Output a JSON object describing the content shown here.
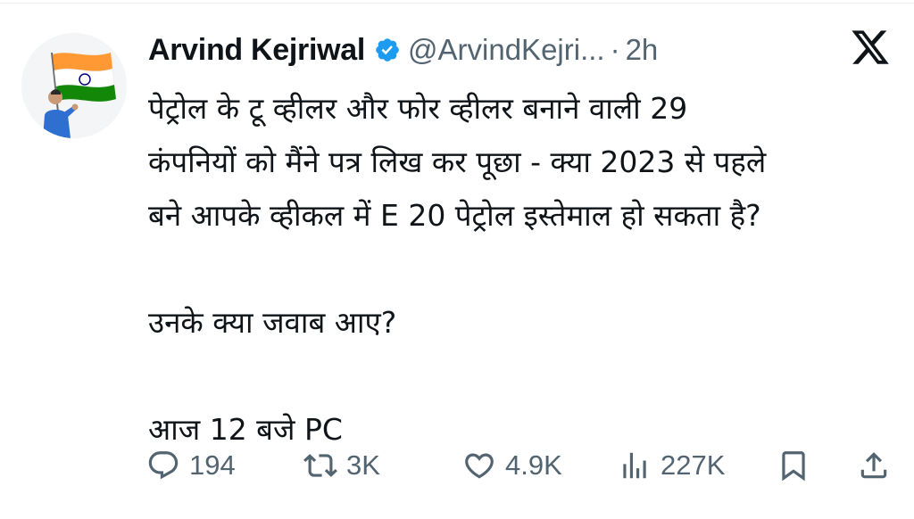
{
  "author": {
    "display_name": "Arvind Kejriwal",
    "handle": "@ArvindKejri...",
    "separator": "·",
    "time": "2h",
    "verified_color": "#1d9bf0"
  },
  "tweet": {
    "text": "पेट्रोल के टू व्हीलर और फोर व्हीलर बनाने वाली 29\nकंपनियों को मैंने पत्र लिख कर पूछा - क्या 2023 से पहले\nबने आपके व्हीकल में E 20 पेट्रोल इस्तेमाल हो सकता है?\n\nउनके क्या जवाब आए?\n\nआज 12 बजे PC"
  },
  "actions": {
    "replies": "194",
    "retweets": "3K",
    "likes": "4.9K",
    "views": "227K"
  },
  "icons": {
    "reply": "reply-icon",
    "retweet": "retweet-icon",
    "like": "heart-icon",
    "views": "views-icon",
    "bookmark": "bookmark-icon",
    "share": "share-icon",
    "logo": "x-logo-icon"
  },
  "colors": {
    "text": "#0f1419",
    "muted": "#536471",
    "flag_saffron": "#ff9933",
    "flag_green": "#138808",
    "flag_chakra": "#000080"
  }
}
